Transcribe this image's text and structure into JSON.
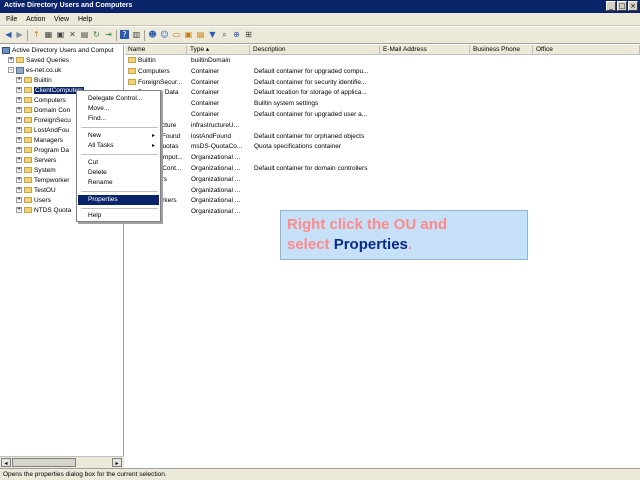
{
  "window": {
    "title": "Active Directory Users and Computers",
    "btn_min": "_",
    "btn_max": "□",
    "btn_close": "×"
  },
  "menu": [
    "File",
    "Action",
    "View",
    "Help"
  ],
  "toolbar": [
    "back-icon",
    "forward-icon",
    "up-icon",
    "properties-icon",
    "console-icon",
    "delete-icon",
    "export-icon",
    "refresh-icon",
    "help-icon",
    "user-icon",
    "group-icon",
    "ou-icon",
    "filter-icon",
    "find-icon",
    "add-to-group-icon"
  ],
  "tree": {
    "root": "Active Directory Users and Comput",
    "saved": "Saved Queries",
    "domain": "es-net.co.uk",
    "items": [
      {
        "label": "Builtin",
        "selected": false
      },
      {
        "label": "ClientComputers",
        "selected": true
      },
      {
        "label": "Computers",
        "selected": false
      },
      {
        "label": "Domain Con",
        "selected": false
      },
      {
        "label": "ForeignSecu",
        "selected": false
      },
      {
        "label": "LostAndFou",
        "selected": false
      },
      {
        "label": "Managers",
        "selected": false
      },
      {
        "label": "Program Da",
        "selected": false
      },
      {
        "label": "Servers",
        "selected": false
      },
      {
        "label": "System",
        "selected": false
      },
      {
        "label": "Tempworker",
        "selected": false
      },
      {
        "label": "TestOU",
        "selected": false
      },
      {
        "label": "Users",
        "selected": false
      },
      {
        "label": "NTDS Quota",
        "selected": false
      }
    ]
  },
  "columns": [
    "Name",
    "Type",
    "Description",
    "E-Mail Address",
    "Business Phone",
    "Office"
  ],
  "rows": [
    {
      "name": "Builtin",
      "type": "builtinDomain",
      "desc": ""
    },
    {
      "name": "Computers",
      "type": "Container",
      "desc": "Default container for upgraded compu..."
    },
    {
      "name": "ForeignSecur...",
      "type": "Container",
      "desc": "Default container for security identifie..."
    },
    {
      "name": "Program Data",
      "type": "Container",
      "desc": "Default location for storage of applica..."
    },
    {
      "name": "System",
      "type": "Container",
      "desc": "Builtin system settings"
    },
    {
      "name": "Users",
      "type": "Container",
      "desc": "Default container for upgraded user a..."
    },
    {
      "name": "Infrastructure",
      "type": "infrastructureU...",
      "desc": ""
    },
    {
      "name": "LostAndFound",
      "type": "lostAndFound",
      "desc": "Default container for orphaned objects"
    },
    {
      "name": "NTDS Quotas",
      "type": "msDS-QuotaCo...",
      "desc": "Quota specifications container"
    },
    {
      "name": "ClientComput...",
      "type": "Organizational ...",
      "desc": ""
    },
    {
      "name": "Domain Cont...",
      "type": "Organizational ...",
      "desc": "Default container for domain controllers"
    },
    {
      "name": "Managers",
      "type": "Organizational ...",
      "desc": ""
    },
    {
      "name": "Servers",
      "type": "Organizational ...",
      "desc": ""
    },
    {
      "name": "Tempworkers",
      "type": "Organizational ...",
      "desc": ""
    },
    {
      "name": "TestOU",
      "type": "Organizational ...",
      "desc": ""
    }
  ],
  "context_menu": {
    "delegate": "Delegate Control...",
    "move": "Move...",
    "find": "Find...",
    "new": "New",
    "all_tasks": "All Tasks",
    "cut": "Cut",
    "delete": "Delete",
    "rename": "Rename",
    "properties": "Properties",
    "help": "Help",
    "submenu_arrow": "▸"
  },
  "callout": {
    "line1": "Right click the OU and",
    "line2_pre": "select ",
    "line2_hl": "Properties",
    "line2_post": "."
  },
  "status": "Opens the properties dialog box for the current selection.",
  "scroll": {
    "left": "◂",
    "right": "▸"
  }
}
